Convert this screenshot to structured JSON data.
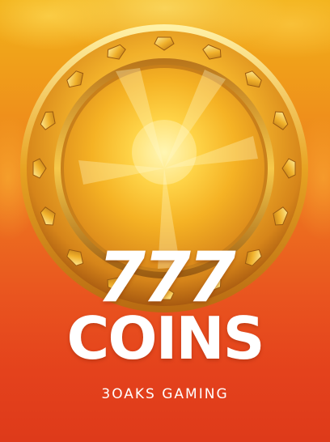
{
  "game": {
    "title_number": "777",
    "title_word": "COINS",
    "studio": "3OAKS GAMING"
  },
  "icons": {
    "main_art": "gold-coin-icon"
  },
  "colors": {
    "background_top": "#f2b21a",
    "background_bottom": "#de3a1a",
    "coin_gold": "#f7c22a",
    "coin_rim": "#d9901a",
    "text": "#ffffff"
  }
}
